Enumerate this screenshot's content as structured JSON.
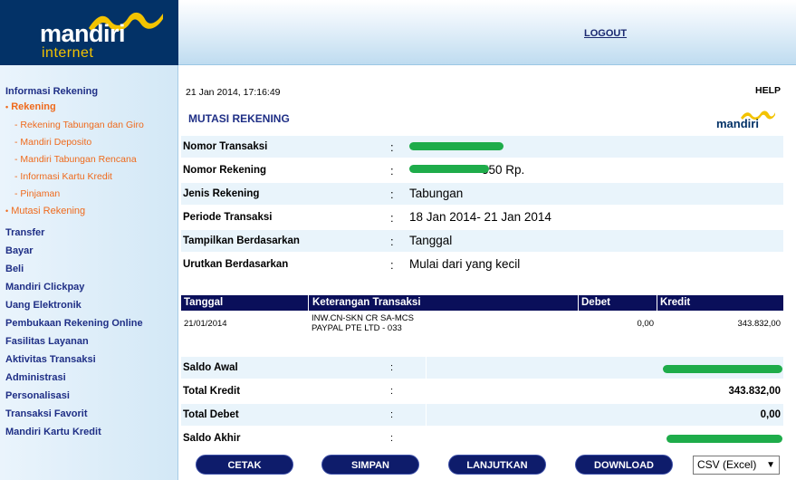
{
  "logo": {
    "mandiri": "mandiri",
    "internet": "internet"
  },
  "header": {
    "logout": "LOGOUT"
  },
  "sidebar": {
    "info_rekening": "Informasi Rekening",
    "rekening": "Rekening",
    "sub_items": [
      "Rekening Tabungan dan Giro",
      "Mandiri Deposito",
      "Mandiri Tabungan Rencana",
      "Informasi Kartu Kredit",
      "Pinjaman"
    ],
    "mutasi": "Mutasi Rekening",
    "menu": [
      "Transfer",
      "Bayar",
      "Beli",
      "Mandiri Clickpay",
      "Uang Elektronik",
      "Pembukaan Rekening Online",
      "Fasilitas Layanan",
      "Aktivitas Transaksi",
      "Administrasi",
      "Personalisasi",
      "Transaksi Favorit",
      "Mandiri Kartu Kredit"
    ]
  },
  "main": {
    "timestamp": "21 Jan 2014, 17:16:49",
    "help": "HELP",
    "title": "MUTASI REKENING",
    "mini_logo": "mandiri",
    "info": [
      {
        "label": "Nomor Transaksi",
        "value": ""
      },
      {
        "label": "Nomor Rekening",
        "value": "550 Rp."
      },
      {
        "label": "Jenis Rekening",
        "value": "Tabungan"
      },
      {
        "label": "Periode Transaksi",
        "value": "18 Jan 2014- 21 Jan 2014"
      },
      {
        "label": "Tampilkan Berdasarkan",
        "value": "Tanggal"
      },
      {
        "label": "Urutkan Berdasarkan",
        "value": "Mulai dari yang kecil"
      }
    ],
    "colon": ":",
    "table": {
      "headers": [
        "Tanggal",
        "Keterangan Transaksi",
        "Debet",
        "Kredit"
      ],
      "rows": [
        {
          "tanggal": "21/01/2014",
          "ket1": "INW.CN-SKN CR SA-MCS",
          "ket2": "PAYPAL PTE LTD - 033",
          "debet": "0,00",
          "kredit": "343.832,00"
        }
      ]
    },
    "summary": [
      {
        "label": "Saldo Awal",
        "value": ""
      },
      {
        "label": "Total Kredit",
        "value": "343.832,00"
      },
      {
        "label": "Total Debet",
        "value": "0,00"
      },
      {
        "label": "Saldo Akhir",
        "value": ""
      }
    ],
    "buttons": {
      "cetak": "CETAK",
      "simpan": "SIMPAN",
      "lanjutkan": "LANJUTKAN",
      "download": "DOWNLOAD"
    },
    "format_select": "CSV (Excel)"
  },
  "colors": {
    "brand_navy": "#033267",
    "brand_gold": "#f3c300",
    "nav_orange": "#ef6a1c",
    "table_header": "#0a0f5a",
    "redaction": "#1eac4a"
  }
}
